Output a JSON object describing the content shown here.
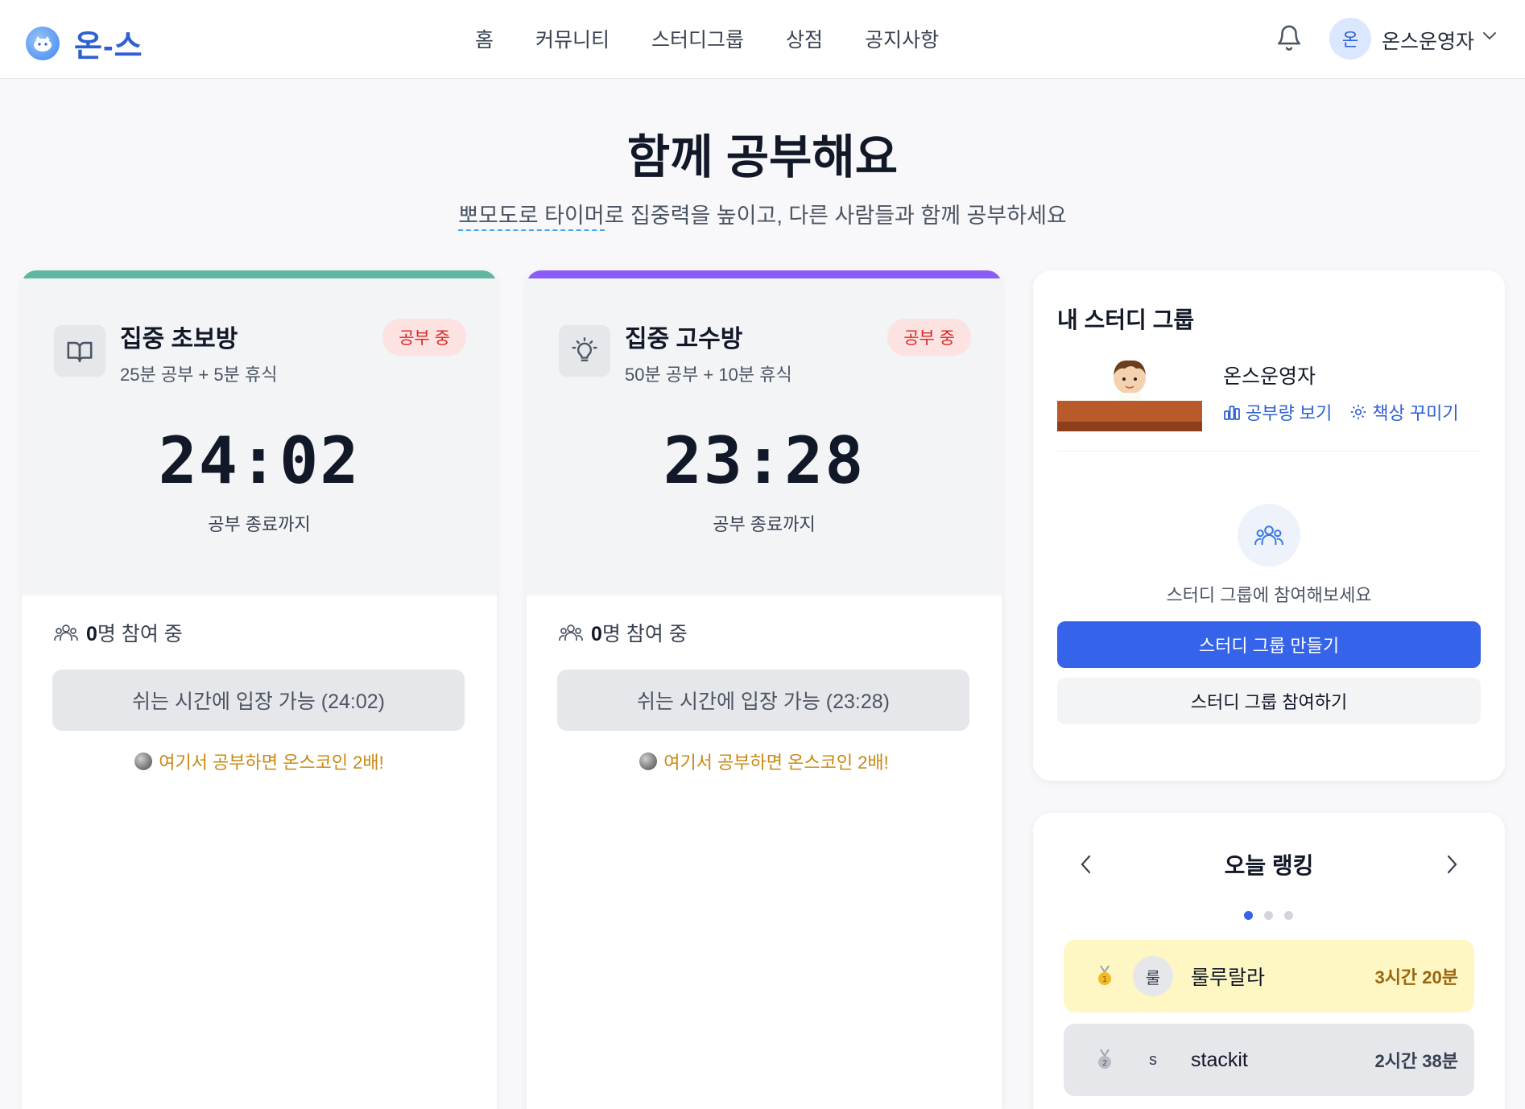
{
  "header": {
    "logo_text": "온-스",
    "nav": [
      "홈",
      "커뮤니티",
      "스터디그룹",
      "상점",
      "공지사항"
    ],
    "user_avatar_initial": "온",
    "user_name": "온스운영자"
  },
  "hero": {
    "title": "함께 공부해요",
    "subtitle_underlined": "뽀모도로 타이머",
    "subtitle_rest": "로 집중력을 높이고, 다른 사람들과 함께 공부하세요"
  },
  "rooms": [
    {
      "name": "집중 초보방",
      "desc": "25분 공부 + 5분 휴식",
      "badge": "공부 중",
      "timer": "24:02",
      "timer_label": "공부 종료까지",
      "participant_count": "0",
      "participant_suffix": "명 참여 중",
      "enter_label": "쉬는 시간에 입장 가능 (24:02)",
      "coin_text": "여기서 공부하면 온스코인 2배!",
      "accent": "#5fb7a2",
      "icon": "book-icon"
    },
    {
      "name": "집중 고수방",
      "desc": "50분 공부 + 10분 휴식",
      "badge": "공부 중",
      "timer": "23:28",
      "timer_label": "공부 종료까지",
      "participant_count": "0",
      "participant_suffix": "명 참여 중",
      "enter_label": "쉬는 시간에 입장 가능 (23:28)",
      "coin_text": "여기서 공부하면 온스코인 2배!",
      "accent": "#8b5cf6",
      "icon": "lightbulb-icon"
    }
  ],
  "study_group": {
    "title": "내 스터디 그룹",
    "user_name": "온스운영자",
    "link_stats": "공부량 보기",
    "link_decorate": "책상 꾸미기",
    "invite_text": "스터디 그룹에 참여해보세요",
    "create_button": "스터디 그룹 만들기",
    "join_button": "스터디 그룹 참여하기"
  },
  "ranking": {
    "title": "오늘 랭킹",
    "entries": [
      {
        "avatar": "룰",
        "name": "룰루랄라",
        "time": "3시간 20분",
        "bg": "#fef7c3",
        "time_color": "#9a6510"
      },
      {
        "avatar": "s",
        "name": "stackit",
        "time": "2시간 38분",
        "bg": "#e5e7eb",
        "time_color": "#374151"
      }
    ]
  },
  "colors": {
    "brand": "#2f5fd6",
    "primary_button": "#3563e9",
    "badge_text": "#dc2626",
    "coin_text": "#c8880f"
  }
}
